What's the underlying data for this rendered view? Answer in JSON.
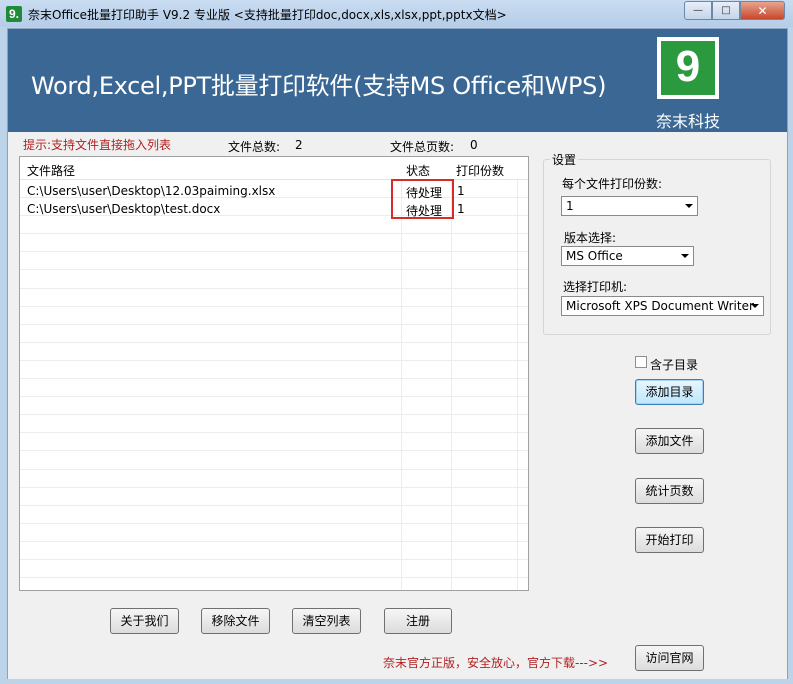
{
  "window": {
    "title": "奈末Office批量打印助手 V9.2  专业版  <支持批量打印doc,docx,xls,xlsx,ppt,pptx文档>",
    "icon_glyph": "9.",
    "min_glyph": "—",
    "max_glyph": "□",
    "close_glyph": "✕"
  },
  "header": {
    "title": "Word,Excel,PPT批量打印软件(支持MS Office和WPS)",
    "logo_glyph": "9",
    "logo_text": "奈末科技",
    "bg_color": "#3a6794",
    "logo_color": "#2b9a3f"
  },
  "hint": "提示:支持文件直接拖入列表",
  "stats": {
    "total_files_label": "文件总数:",
    "total_files_value": "2",
    "total_pages_label": "文件总页数:",
    "total_pages_value": "0"
  },
  "table": {
    "columns": [
      "文件路径",
      "状态",
      "打印份数"
    ],
    "rows": [
      {
        "path": "C:\\Users\\user\\Desktop\\12.03paiming.xlsx",
        "status": "待处理",
        "copies": "1"
      },
      {
        "path": "C:\\Users\\user\\Desktop\\test.docx",
        "status": "待处理",
        "copies": "1"
      }
    ]
  },
  "settings": {
    "group_title": "设置",
    "copies_label": "每个文件打印份数:",
    "copies_value": "1",
    "version_label": "版本选择:",
    "version_value": "MS Office",
    "printer_label": "选择打印机:",
    "printer_value": "Microsoft XPS Document Writer"
  },
  "side": {
    "include_subdir_label": "含子目录",
    "include_subdir_checked": false,
    "add_dir": "添加目录",
    "add_file": "添加文件",
    "count_pages": "统计页数",
    "start_print": "开始打印"
  },
  "bottom": {
    "about": "关于我们",
    "remove_file": "移除文件",
    "clear_list": "清空列表",
    "register": "注册",
    "official_text": "奈末官方正版，安全放心，官方下载--->>",
    "visit_site": "访问官网"
  }
}
